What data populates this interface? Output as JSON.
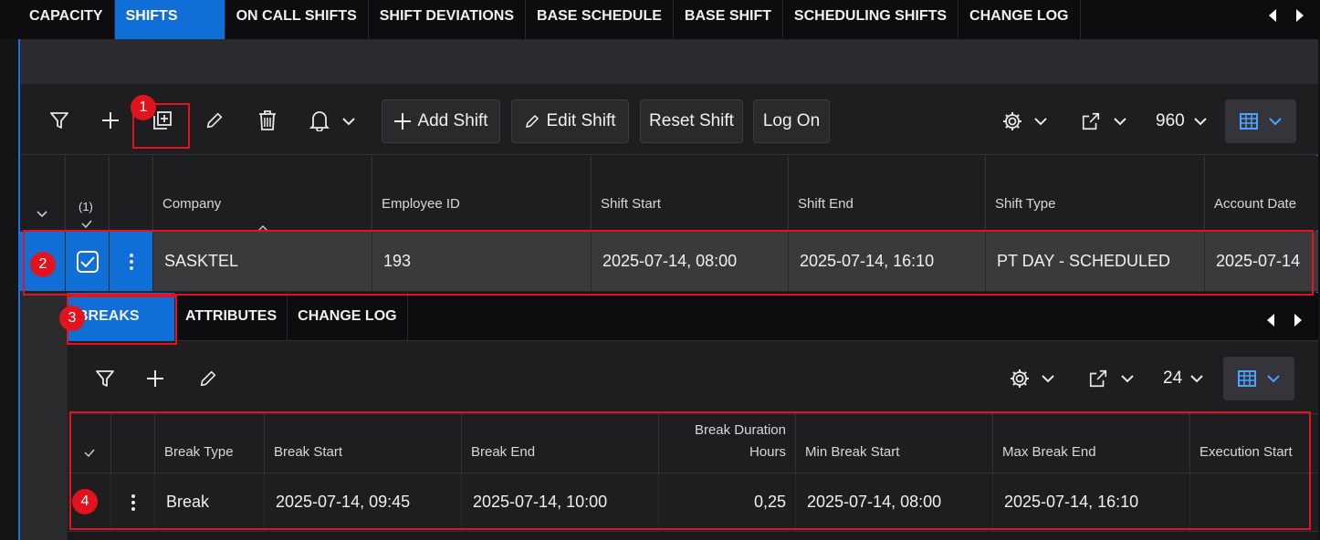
{
  "top_tabs": [
    "CAPACITY",
    "SHIFTS",
    "ON CALL SHIFTS",
    "SHIFT DEVIATIONS",
    "BASE SCHEDULE",
    "BASE SHIFT",
    "SCHEDULING SHIFTS",
    "CHANGE LOG"
  ],
  "active_top_tab": "SHIFTS",
  "toolbar": {
    "add_shift": "Add Shift",
    "edit_shift": "Edit Shift",
    "reset_shift": "Reset Shift",
    "log_on": "Log On",
    "page_size": "960"
  },
  "grid": {
    "selected_count": "(1)",
    "columns": [
      "Company",
      "Employee ID",
      "Shift Start",
      "Shift End",
      "Shift Type",
      "Account Date"
    ],
    "row": {
      "company": "SASKTEL",
      "employee_id": "193",
      "shift_start": "2025-07-14, 08:00",
      "shift_end": "2025-07-14, 16:10",
      "shift_type": "PT DAY - SCHEDULED",
      "account_date": "2025-07-14"
    }
  },
  "sub_tabs": [
    "BREAKS",
    "ATTRIBUTES",
    "CHANGE LOG"
  ],
  "sub_toolbar": {
    "page_size": "24"
  },
  "breaks_grid": {
    "columns": {
      "break_type": "Break Type",
      "break_start": "Break Start",
      "break_end": "Break End",
      "break_duration_1": "Break Duration",
      "break_duration_2": "Hours",
      "min_break_start": "Min Break Start",
      "max_break_end": "Max Break End",
      "execution_start": "Execution Start"
    },
    "row": {
      "break_type": "Break",
      "break_start": "2025-07-14, 09:45",
      "break_end": "2025-07-14, 10:00",
      "duration": "0,25",
      "min_break_start": "2025-07-14, 08:00",
      "max_break_end": "2025-07-14, 16:10",
      "execution_start": ""
    }
  },
  "markers": [
    "1",
    "2",
    "3",
    "4"
  ],
  "colors": {
    "accent": "#0f6fd6",
    "highlight": "#e0141e"
  }
}
